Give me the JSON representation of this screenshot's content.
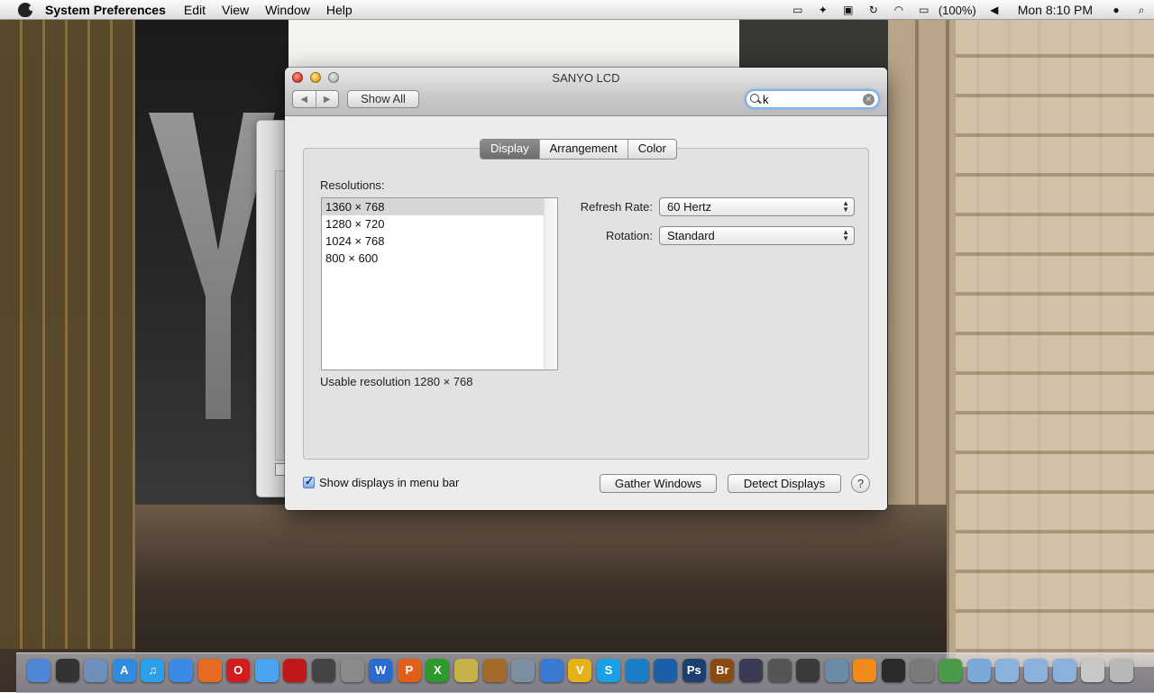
{
  "menubar": {
    "app_name": "System Preferences",
    "items": [
      "Edit",
      "View",
      "Window",
      "Help"
    ],
    "status_icons": [
      "display-mirror-icon",
      "twitter-icon",
      "monitor-icon",
      "sync-icon",
      "wifi-icon",
      "battery-icon",
      "volume-icon",
      "user-icon",
      "spotlight-icon"
    ],
    "battery_percent": "(100%)",
    "clock": "Mon 8:10 PM"
  },
  "window": {
    "title": "SANYO LCD",
    "show_all_label": "Show All",
    "search_value": "k",
    "tabs": [
      {
        "label": "Display",
        "active": true
      },
      {
        "label": "Arrangement",
        "active": false
      },
      {
        "label": "Color",
        "active": false
      }
    ],
    "resolutions_label": "Resolutions:",
    "resolutions": [
      "1360 × 768",
      "1280 × 720",
      "1024 × 768",
      "800 × 600"
    ],
    "selected_resolution": "1360 × 768",
    "usable_resolution": "Usable resolution 1280 × 768",
    "refresh_rate_label": "Refresh Rate:",
    "refresh_rate_value": "60 Hertz",
    "rotation_label": "Rotation:",
    "rotation_value": "Standard",
    "show_in_menubar_label": "Show displays in menu bar",
    "show_in_menubar_checked": true,
    "gather_windows_label": "Gather Windows",
    "detect_displays_label": "Detect Displays",
    "help_label": "?"
  },
  "dock": {
    "icons": [
      {
        "name": "finder-icon",
        "color": "#4f86d6",
        "glyph": ""
      },
      {
        "name": "dashboard-icon",
        "color": "#333333",
        "glyph": ""
      },
      {
        "name": "preview-icon",
        "color": "#6d8fb8",
        "glyph": ""
      },
      {
        "name": "app-store-icon",
        "color": "#2f8be0",
        "glyph": "A"
      },
      {
        "name": "itunes-icon",
        "color": "#2aa0e8",
        "glyph": "♫"
      },
      {
        "name": "safari-icon",
        "color": "#3b8be6",
        "glyph": ""
      },
      {
        "name": "firefox-icon",
        "color": "#e66a1f",
        "glyph": ""
      },
      {
        "name": "opera-icon",
        "color": "#d11d1d",
        "glyph": "O"
      },
      {
        "name": "messages-icon",
        "color": "#4aa3f0",
        "glyph": ""
      },
      {
        "name": "photo-booth-icon",
        "color": "#c01818",
        "glyph": ""
      },
      {
        "name": "camera-icon",
        "color": "#444444",
        "glyph": ""
      },
      {
        "name": "system-preferences-icon",
        "color": "#8a8a8a",
        "glyph": ""
      },
      {
        "name": "word-icon",
        "color": "#2b6bd1",
        "glyph": "W"
      },
      {
        "name": "powerpoint-icon",
        "color": "#e0601a",
        "glyph": "P"
      },
      {
        "name": "excel-icon",
        "color": "#2c9a2c",
        "glyph": "X"
      },
      {
        "name": "utility-icon",
        "color": "#c7b24a",
        "glyph": ""
      },
      {
        "name": "guitar-icon",
        "color": "#a46a2a",
        "glyph": ""
      },
      {
        "name": "iphoto-icon",
        "color": "#7b8fa0",
        "glyph": ""
      },
      {
        "name": "dvd-icon",
        "color": "#3a7ad0",
        "glyph": ""
      },
      {
        "name": "vlc-v-icon",
        "color": "#e6b21a",
        "glyph": "V"
      },
      {
        "name": "skype-icon",
        "color": "#1aa0e6",
        "glyph": "S"
      },
      {
        "name": "circle-app-icon",
        "color": "#1a7ec8",
        "glyph": ""
      },
      {
        "name": "tweetdeck-icon",
        "color": "#1b5fa8",
        "glyph": ""
      },
      {
        "name": "photoshop-icon",
        "color": "#1c3f72",
        "glyph": "Ps"
      },
      {
        "name": "bridge-icon",
        "color": "#8a4a10",
        "glyph": "Br"
      },
      {
        "name": "final-cut-icon",
        "color": "#3a3a55",
        "glyph": ""
      },
      {
        "name": "script-icon",
        "color": "#555555",
        "glyph": ""
      },
      {
        "name": "network-icon",
        "color": "#3a3a3a",
        "glyph": ""
      },
      {
        "name": "disk-utility-icon",
        "color": "#6a8aa6",
        "glyph": ""
      },
      {
        "name": "vlc-icon",
        "color": "#f08a1a",
        "glyph": ""
      },
      {
        "name": "ninja-icon",
        "color": "#2a2a2a",
        "glyph": ""
      },
      {
        "name": "tools-icon",
        "color": "#7a7a7a",
        "glyph": ""
      },
      {
        "name": "app-icon",
        "color": "#4a9a4a",
        "glyph": ""
      },
      {
        "name": "applications-folder-icon",
        "color": "#7aa8d8",
        "glyph": ""
      },
      {
        "name": "documents-folder-icon",
        "color": "#8ab2dc",
        "glyph": ""
      },
      {
        "name": "downloads-folder-icon",
        "color": "#8ab2dc",
        "glyph": ""
      },
      {
        "name": "folder-icon",
        "color": "#8ab2dc",
        "glyph": ""
      },
      {
        "name": "screen-icon",
        "color": "#c8c8c8",
        "glyph": ""
      },
      {
        "name": "trash-icon",
        "color": "#b8b8b8",
        "glyph": ""
      }
    ]
  }
}
